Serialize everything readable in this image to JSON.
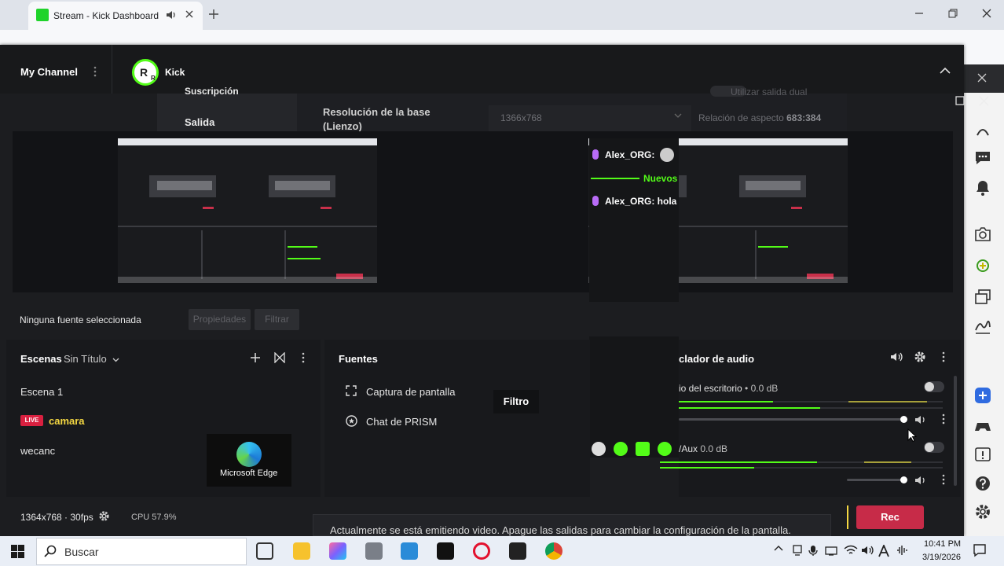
{
  "browser": {
    "tab_title": "Stream - Kick Dashboard",
    "new_tab": "+"
  },
  "header": {
    "channel_name": "My Channel",
    "avatar_letter": "R",
    "avatar_letter_small": "R",
    "platform_name": "Kick"
  },
  "settings_dialog": {
    "prev_section": "Suscripción",
    "output_section": "Salida",
    "resolution_label_1": "Resolución de la base",
    "resolution_label_2": "(Lienzo)",
    "resolution_value": "1366x768",
    "aspect_label": "Relación de aspecto",
    "aspect_value": "683:384",
    "dual_output_label": "Utilizar salida dual"
  },
  "chat": {
    "line1": "Alex_ORG:",
    "new_label": "Nuevos",
    "line2": "Alex_ORG: hola"
  },
  "source_bar": {
    "no_source": "Ninguna fuente seleccionada",
    "properties": "Propiedades",
    "filter": "Filtrar"
  },
  "scenes": {
    "title": "Escenas",
    "collection": "Sin Título",
    "items": [
      "Escena 1",
      "camara",
      "wecanc"
    ],
    "live_badge": "LIVE"
  },
  "sources": {
    "title": "Fuentes",
    "items": [
      "Captura de pantalla",
      "Chat de PRISM"
    ],
    "tooltip": "Filtro"
  },
  "mixer": {
    "title": "clador de audio",
    "channel1": "io del escritorio",
    "channel1_db": "• 0.0 dB",
    "channel2": "/Aux",
    "channel2_db": "0.0 dB",
    "channel1_volume_pct": 100,
    "channel2_volume_pct": 100
  },
  "edge": {
    "label": "Microsoft Edge"
  },
  "status": {
    "resolution": "1364x768 · 30fps",
    "cpu": "CPU 57.9%",
    "notice": "Actualmente se está emitiendo video. Apague las salidas para cambiar la configuración de la pantalla.",
    "rec": "Rec"
  },
  "taskbar": {
    "search": "Buscar",
    "time": "10:41 PM",
    "date": "3/19/2026"
  },
  "colors": {
    "accent_green": "#53fc18",
    "live_red": "#d92040",
    "rec_red": "#c72b48",
    "scene_active_yellow": "#f5d842"
  }
}
